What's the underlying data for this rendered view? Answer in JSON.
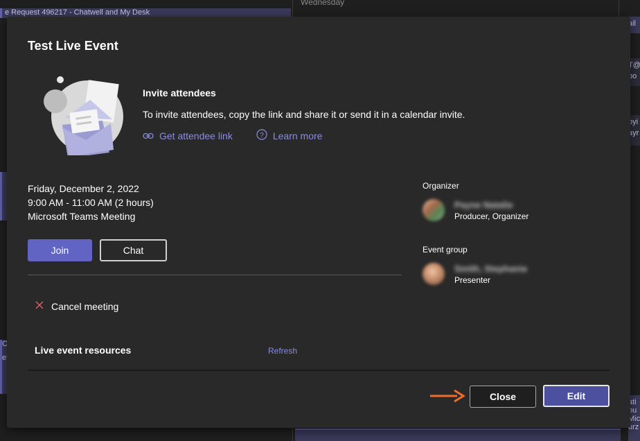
{
  "background": {
    "day_header": "Wednesday",
    "events": [
      {
        "text": "e Request 496217 - Chatwell and My Desk"
      },
      {
        "text": "Ca"
      },
      {
        "text": "et"
      },
      {
        "text": "ail"
      },
      {
        "text": "T@"
      },
      {
        "text": "po"
      },
      {
        "text": "oyi"
      },
      {
        "text": "ayr"
      },
      {
        "text": "ati"
      },
      {
        "text": "ou"
      },
      {
        "text": "Mic"
      },
      {
        "text": "urz"
      }
    ]
  },
  "modal": {
    "title": "Test Live Event",
    "invite": {
      "heading": "Invite attendees",
      "description": "To invite attendees, copy the link and share it or send it in a calendar invite.",
      "get_link_label": "Get attendee link",
      "learn_more_label": "Learn more"
    },
    "details": {
      "date": "Friday, December 2, 2022",
      "time": "9:00 AM - 11:00 AM (2 hours)",
      "type": "Microsoft Teams Meeting"
    },
    "buttons": {
      "join": "Join",
      "chat": "Chat",
      "close": "Close",
      "edit": "Edit"
    },
    "cancel_label": "Cancel meeting",
    "resources": {
      "title": "Live event resources",
      "refresh": "Refresh"
    },
    "organizer": {
      "heading": "Organizer",
      "name": "Payne Natalie",
      "role": "Producer, Organizer"
    },
    "event_group": {
      "heading": "Event group",
      "name": "Smith, Stephanie",
      "role": "Presenter"
    }
  },
  "colors": {
    "accent": "#6264c4",
    "link": "#8b8cde",
    "cancel_icon": "#e05f6a",
    "arrow": "#f36c2a"
  }
}
